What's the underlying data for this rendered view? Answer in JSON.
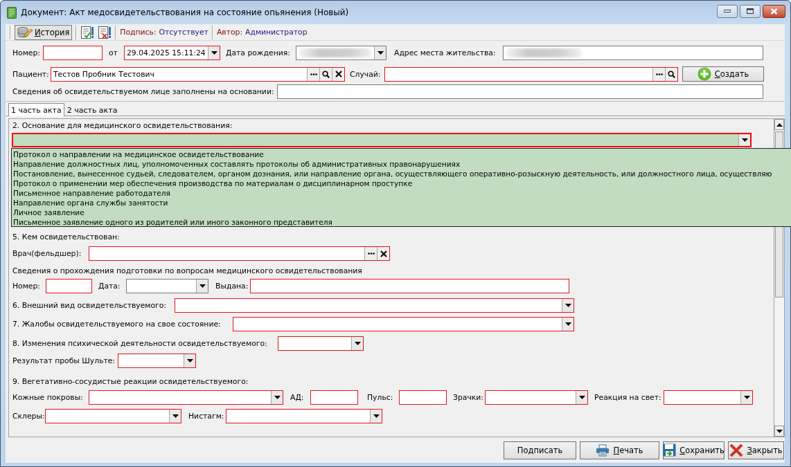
{
  "window": {
    "title": "Документ: Акт медосвидетельствования на состояние опьянения (Новый)"
  },
  "toolbar": {
    "history_button": {
      "label": "История",
      "mnemonic": true
    },
    "signature_label": "Подпись:",
    "signature_value": "Отсутствует",
    "author_label": "Автор:",
    "author_value": "Администратор"
  },
  "header": {
    "rows": [
      {
        "items": [
          {
            "kind": "label",
            "text": "Номер:"
          },
          {
            "kind": "text",
            "required": true
          },
          {
            "kind": "label",
            "text": "от"
          },
          {
            "kind": "combo",
            "value": "29.04.2025 15:11:24",
            "required": true
          },
          {
            "kind": "label",
            "text": "Дата рождения:"
          },
          {
            "kind": "combo",
            "required": false,
            "blurred": true
          },
          {
            "kind": "label",
            "text": "Адрес места жительства:"
          },
          {
            "kind": "text",
            "required": false,
            "blurred": true
          }
        ]
      },
      {
        "items": [
          {
            "kind": "label",
            "text": "Пациент:"
          },
          {
            "kind": "lookup",
            "value": "Тестов Пробник Тестович",
            "required": true,
            "clearable": true
          },
          {
            "kind": "label",
            "text": "Случай:"
          },
          {
            "kind": "lookup",
            "required": true,
            "clearable": false
          },
          {
            "kind": "button",
            "label": "Создать",
            "mnemonic": true
          }
        ]
      },
      {
        "items": [
          {
            "kind": "label",
            "text": "Сведения об освидетельствуемом лице заполнены на основании:"
          },
          {
            "kind": "text",
            "required": false
          }
        ]
      }
    ]
  },
  "tabs": [
    {
      "label": "1 часть акта",
      "selected": true
    },
    {
      "label": "2 часть акта",
      "selected": false
    }
  ],
  "form": {
    "rows": [
      {
        "items": [
          {
            "kind": "heading",
            "text": "2. Основание для медицинского освидетельствования:"
          }
        ]
      },
      {
        "items": [
          {
            "kind": "combo",
            "required": true,
            "expanded": true,
            "options": [
              {
                "text": "Протокол о направлении на медицинское освидетельствование",
                "selected": false
              },
              {
                "text": "Направление должностных лиц, уполномоченных составлять протоколы об административных правонарушениях",
                "selected": false
              },
              {
                "text": "Постановление, вынесенное судьей, следователем, органом дознания, или направление органа, осуществляющего оперативно-розыскную деятельность, или должностного лица, осуществляю",
                "selected": false
              },
              {
                "text": "Протокол о применении мер обеспечения производства по материалам о дисциплинарном проступке",
                "selected": false
              },
              {
                "text": "Письменное направление работодателя",
                "selected": false
              },
              {
                "text": "Направление органа службы занятости",
                "selected": false
              },
              {
                "text": "Личное заявление",
                "selected": false
              },
              {
                "text": "Письменное заявление одного из родителей или иного законного представителя",
                "selected": false
              }
            ]
          }
        ]
      },
      {
        "items": [
          {
            "kind": "heading",
            "text": "5. Кем освидетельствован:"
          }
        ]
      },
      {
        "items": [
          {
            "kind": "label",
            "text": "Врач(фельдшер):"
          },
          {
            "kind": "lookup",
            "required": true,
            "clearable": true,
            "search": false
          }
        ]
      },
      {
        "items": [
          {
            "kind": "heading",
            "text": "Сведения о прохождения подготовки по вопросам медицинского освидетельствования"
          }
        ]
      },
      {
        "items": [
          {
            "kind": "label",
            "text": "Номер:"
          },
          {
            "kind": "text",
            "required": true
          },
          {
            "kind": "label",
            "text": "Дата:"
          },
          {
            "kind": "combo",
            "required": false
          },
          {
            "kind": "label",
            "text": "Выдана:"
          },
          {
            "kind": "text",
            "required": true
          }
        ]
      },
      {
        "items": [
          {
            "kind": "label",
            "text": "6. Внешний вид освидетельствуемого:"
          },
          {
            "kind": "combo",
            "required": true
          }
        ]
      },
      {
        "items": [
          {
            "kind": "label",
            "text": "7. Жалобы освидетельствуемого на свое состояние:"
          },
          {
            "kind": "combo",
            "required": true
          }
        ]
      },
      {
        "items": [
          {
            "kind": "label",
            "text": "8. Изменения психической деятельности освидетельствуемого:"
          },
          {
            "kind": "combo",
            "required": true
          }
        ]
      },
      {
        "items": [
          {
            "kind": "label",
            "text": "Результат пробы Шульте:"
          },
          {
            "kind": "combo",
            "required": true
          }
        ]
      },
      {
        "items": [
          {
            "kind": "heading",
            "text": "9. Вегетативно-сосудистые реакции освидетельствуемого:"
          }
        ]
      },
      {
        "items": [
          {
            "kind": "label",
            "text": "Кожные покровы:"
          },
          {
            "kind": "combo",
            "required": true
          },
          {
            "kind": "label",
            "text": "АД:"
          },
          {
            "kind": "text",
            "required": true
          },
          {
            "kind": "label",
            "text": "Пульс:"
          },
          {
            "kind": "text",
            "required": true
          },
          {
            "kind": "label",
            "text": "Зрачки:"
          },
          {
            "kind": "combo",
            "required": true
          },
          {
            "kind": "label",
            "text": "Реакция на свет:"
          },
          {
            "kind": "combo",
            "required": true
          }
        ]
      },
      {
        "items": [
          {
            "kind": "label",
            "text": "Склеры:"
          },
          {
            "kind": "combo",
            "required": true
          },
          {
            "kind": "label",
            "text": "Нистагм:"
          },
          {
            "kind": "combo",
            "required": true
          }
        ]
      }
    ]
  },
  "buttons": [
    {
      "label": "Подписать",
      "mnemonic": false
    },
    {
      "label": "Печать",
      "mnemonic": true
    },
    {
      "label": "Сохранить",
      "mnemonic": true
    },
    {
      "label": "Закрыть",
      "mnemonic": true
    }
  ]
}
